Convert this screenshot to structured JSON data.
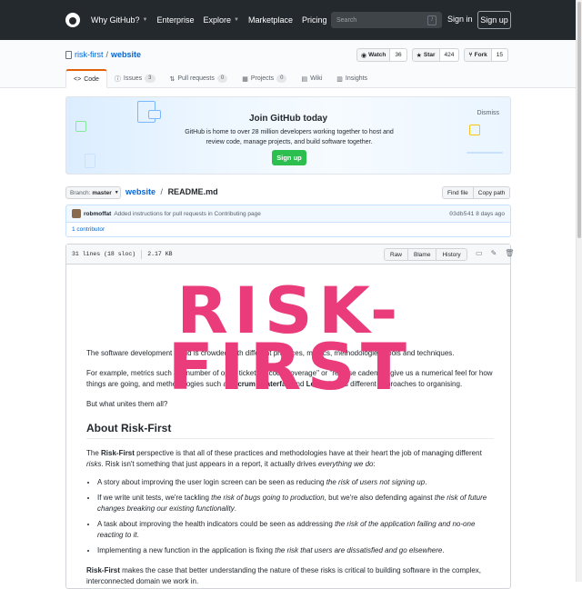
{
  "header": {
    "nav": [
      {
        "label": "Why GitHub?",
        "chevron": true
      },
      {
        "label": "Enterprise",
        "chevron": false
      },
      {
        "label": "Explore",
        "chevron": true
      },
      {
        "label": "Marketplace",
        "chevron": false
      },
      {
        "label": "Pricing",
        "chevron": true
      }
    ],
    "search_placeholder": "Search",
    "search_shortcut": "/",
    "signin": "Sign in",
    "signup": "Sign up"
  },
  "repo": {
    "owner": "risk-first",
    "separator": "/",
    "name": "website",
    "watch": {
      "label": "Watch",
      "count": "36"
    },
    "star": {
      "label": "Star",
      "count": "424"
    },
    "fork": {
      "label": "Fork",
      "count": "15"
    }
  },
  "tabs": [
    {
      "label": "Code",
      "icon": "code-icon",
      "glyph": "<>",
      "count": null
    },
    {
      "label": "Issues",
      "icon": "issue-icon",
      "glyph": "ⓘ",
      "count": "3"
    },
    {
      "label": "Pull requests",
      "icon": "pull-request-icon",
      "glyph": "⇅",
      "count": "0"
    },
    {
      "label": "Projects",
      "icon": "project-icon",
      "glyph": "▦",
      "count": "0"
    },
    {
      "label": "Wiki",
      "icon": "book-icon",
      "glyph": "▤",
      "count": null
    },
    {
      "label": "Insights",
      "icon": "graph-icon",
      "glyph": "▥",
      "count": null
    }
  ],
  "join": {
    "title": "Join GitHub today",
    "text": "GitHub is home to over 28 million developers working together to host and review code, manage projects, and build software together.",
    "button": "Sign up",
    "dismiss": "Dismiss"
  },
  "breadcrumb": {
    "branch_label": "Branch:",
    "branch": "master",
    "repo": "website",
    "separator": "/",
    "file": "README.md",
    "find_file": "Find file",
    "copy_path": "Copy path"
  },
  "commit": {
    "author": "robmoffat",
    "message": "Added instructions for pull requests in Contributing page",
    "sha": "03db541",
    "time": "8 days ago",
    "contributors": "1 contributor"
  },
  "file": {
    "lines": "31 lines (18 sloc)",
    "size": "2.17 KB",
    "raw": "Raw",
    "blame": "Blame",
    "history": "History"
  },
  "readme": {
    "logo_text": "RISK-FIRST",
    "p1": "The software development world is crowded with different practices, metrics, methodologies, tools and techniques.",
    "p2_parts": [
      "For example, metrics such as \"number of open tickets\", \"code coverage\" or \"release cadence\" give us a numerical feel for how things are going, and methodologies such as ",
      "Scrum",
      ", ",
      "Waterfall",
      " and ",
      "Lean",
      " give us different approaches to organising."
    ],
    "p3": "But what unites them all?",
    "h2": "About Risk-First",
    "p4_parts": [
      "The ",
      "Risk-First",
      " perspective is that all of these practices and methodologies have at their heart the job of managing different ",
      "risks",
      ". Risk isn't something that just appears in a report, it actually drives ",
      "everything we do",
      ":"
    ],
    "bullets": [
      [
        "A story about improving the user login screen can be seen as reducing ",
        "the risk of users not signing up",
        "."
      ],
      [
        "If we write unit tests, we're tackling ",
        "the risk of bugs going to production",
        ", but we're also defending against ",
        "the risk of future changes breaking our existing functionality",
        "."
      ],
      [
        "A task about improving the health indicators could be seen as addressing ",
        "the risk of the application failing and no-one reacting to it",
        "."
      ],
      [
        "Implementing a new function in the application is fixing ",
        "the risk that users are dissatisfied and go elsewhere",
        "."
      ]
    ],
    "p5_parts": [
      "Risk-First",
      " makes the case that better understanding the nature of these risks is critical to building software in the complex, interconnected domain we work in."
    ]
  }
}
